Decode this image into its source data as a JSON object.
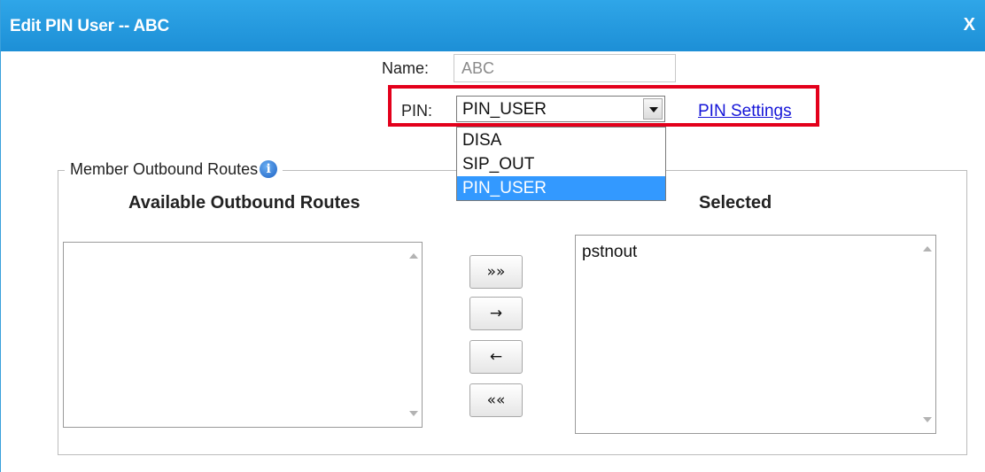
{
  "dialog": {
    "title": "Edit PIN User -- ABC",
    "close_label": "X"
  },
  "form": {
    "name_label": "Name:",
    "name_value": "ABC",
    "pin_label": "PIN:",
    "pin_value": "PIN_USER",
    "pin_options": [
      "DISA",
      "SIP_OUT",
      "PIN_USER"
    ],
    "pin_settings_link": "PIN Settings"
  },
  "routes": {
    "legend": "Member Outbound Routes",
    "available_header": "Available Outbound Routes",
    "selected_header": "Selected",
    "available_items": [],
    "selected_items": [
      "pstnout"
    ],
    "buttons": {
      "add_all": "»»",
      "add": "→",
      "remove": "←",
      "remove_all": "««"
    }
  },
  "colors": {
    "titlebar": "#1d8fd6",
    "highlight": "#e3001b",
    "link": "#1515d8",
    "option_selected": "#3399ff"
  },
  "icons": {
    "legend_info": "info-icon",
    "dropdown": "chevron-down-icon"
  }
}
